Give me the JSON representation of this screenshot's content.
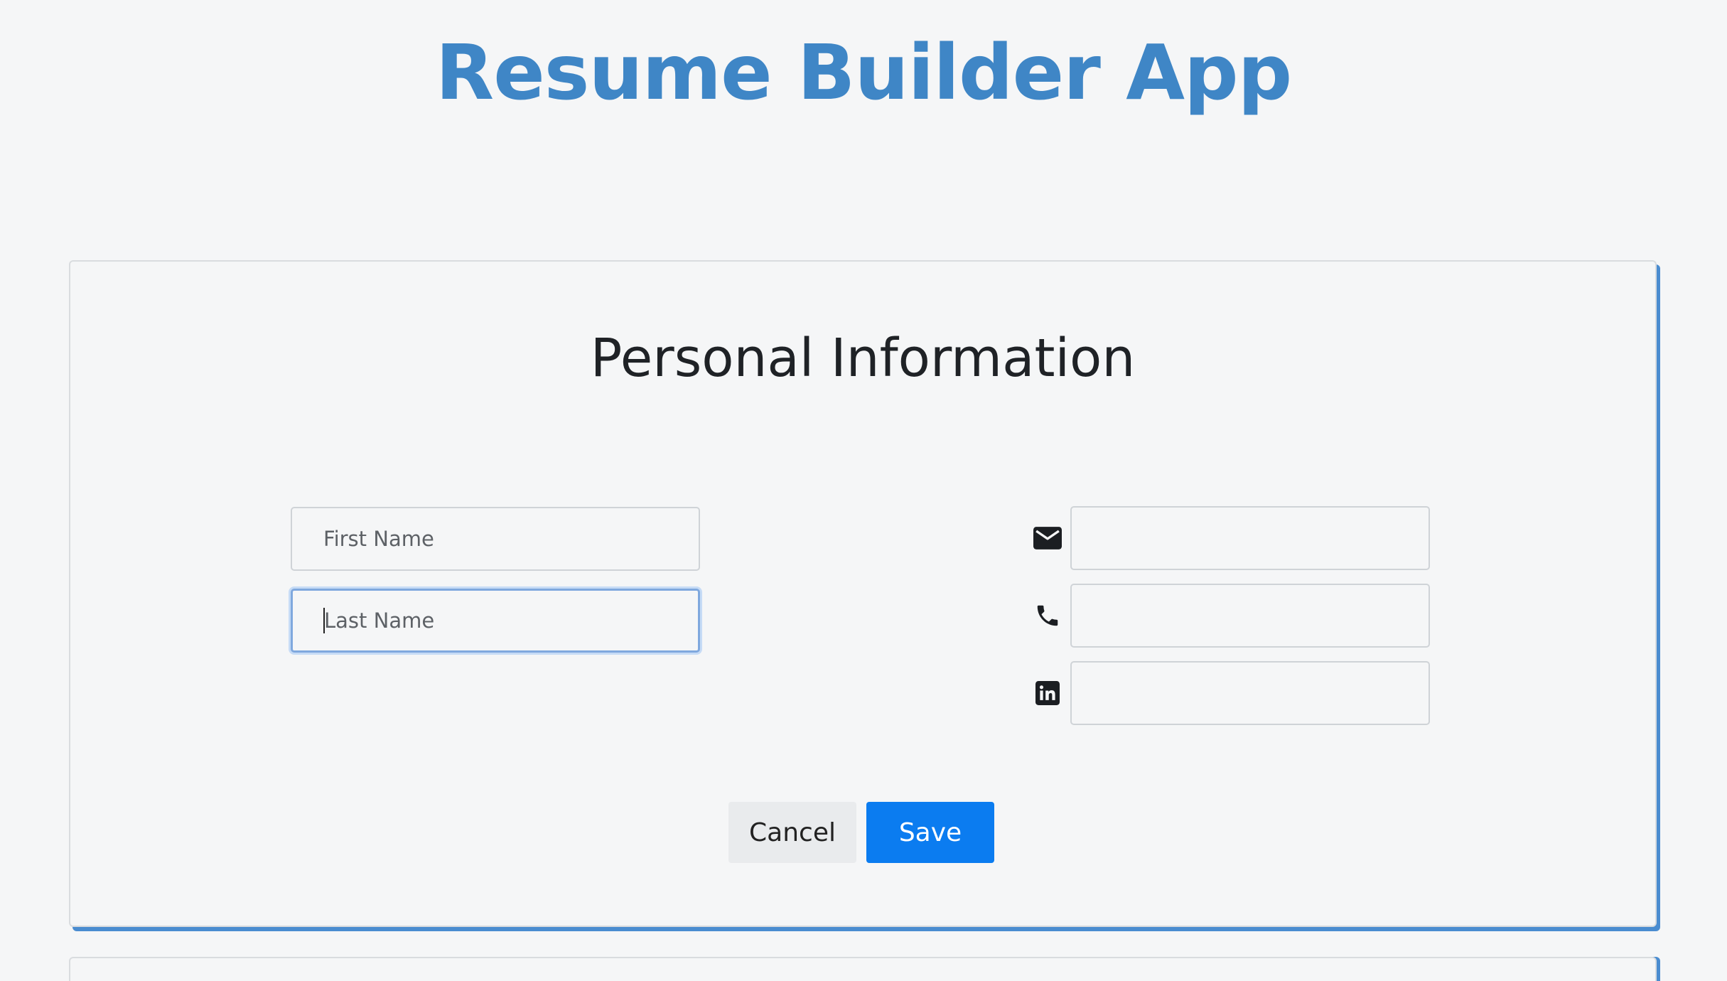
{
  "app": {
    "title": "Resume Builder App"
  },
  "personal_info": {
    "section_title": "Personal Information",
    "first_name": {
      "placeholder": "First Name",
      "value": ""
    },
    "last_name": {
      "placeholder": "Last Name",
      "value": "",
      "focused": true
    },
    "email": {
      "icon": "mail-icon",
      "value": ""
    },
    "phone": {
      "icon": "phone-icon",
      "value": ""
    },
    "linkedin": {
      "icon": "linkedin-icon",
      "value": ""
    },
    "buttons": {
      "cancel_label": "Cancel",
      "save_label": "Save"
    }
  },
  "colors": {
    "title": "#3f86c6",
    "card_accent_shadow": "#4a8cd0",
    "primary_button": "#0b7cf0",
    "secondary_button": "#e9ebed",
    "background": "#f5f6f7"
  }
}
